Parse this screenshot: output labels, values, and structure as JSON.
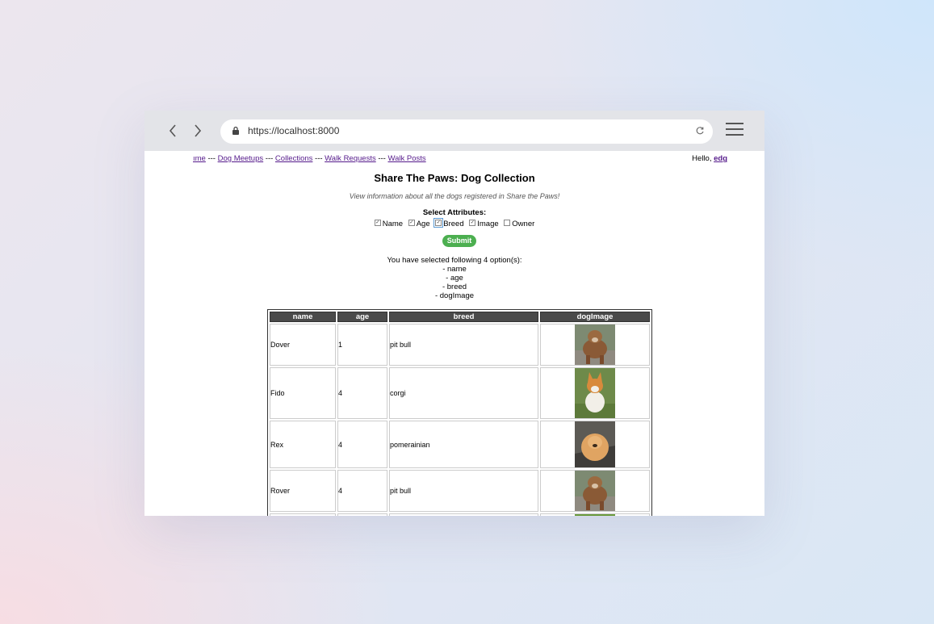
{
  "browser": {
    "url": "https://localhost:8000"
  },
  "nav": {
    "home_partial": "ıme",
    "sep": " --- ",
    "links": [
      "Dog Meetups",
      "Collections",
      "Walk Requests",
      "Walk Posts"
    ],
    "hello_prefix": "Hello, ",
    "user": "edg"
  },
  "page": {
    "title": "Share The Paws: Dog Collection",
    "subtitle": "View information about all the dogs registered in Share the Paws!",
    "select_title": "Select Attributes:",
    "attributes": [
      {
        "label": "Name",
        "checked": true
      },
      {
        "label": "Age",
        "checked": true
      },
      {
        "label": "Breed",
        "checked": true
      },
      {
        "label": "Image",
        "checked": true
      },
      {
        "label": "Owner",
        "checked": false
      }
    ],
    "submit_label": "Submit",
    "selected_header": "You have selected following 4 option(s):",
    "selected_items": [
      "- name",
      "- age",
      "- breed",
      "- dogImage"
    ]
  },
  "table": {
    "headers": [
      "name",
      "age",
      "breed",
      "dogImage"
    ],
    "rows": [
      {
        "name": "Dover",
        "age": "1",
        "breed": "pit bull",
        "image": "pitbull"
      },
      {
        "name": "Fido",
        "age": "4",
        "breed": "corgi",
        "image": "corgi"
      },
      {
        "name": "Rex",
        "age": "4",
        "breed": "pomerainian",
        "image": "pomeranian"
      },
      {
        "name": "Rover",
        "age": "4",
        "breed": "pit bull",
        "image": "pitbull"
      },
      {
        "name": "",
        "age": "",
        "breed": "",
        "image": "husky"
      }
    ]
  }
}
